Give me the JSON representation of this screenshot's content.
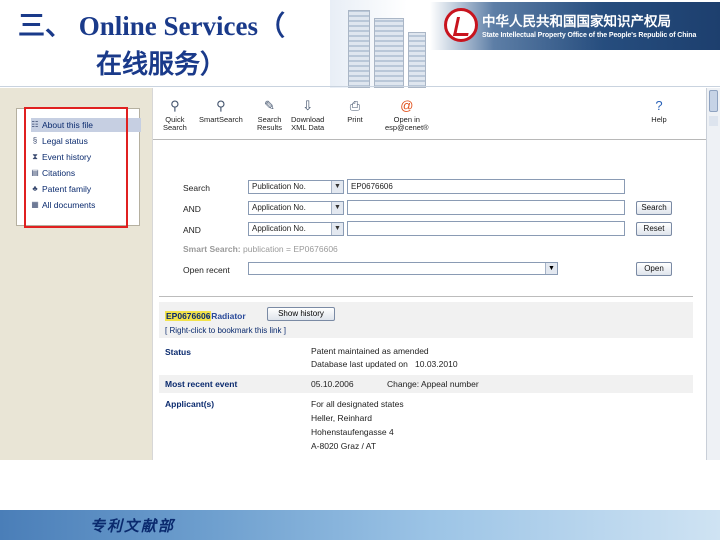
{
  "slide": {
    "title_line1": "三、 Online Services（",
    "title_line2": "在线服务）",
    "org_name_cn": "中华人民共和国国家知识产权局",
    "org_name_en": "State Intellectual Property Office of the People's Republic of China",
    "footer_text": "专利文献部"
  },
  "nav": {
    "items": [
      {
        "label": "About this file",
        "icon": "list-icon"
      },
      {
        "label": "Legal status",
        "icon": "legal-status-icon"
      },
      {
        "label": "Event history",
        "icon": "hourglass-icon"
      },
      {
        "label": "Citations",
        "icon": "citations-icon"
      },
      {
        "label": "Patent family",
        "icon": "family-icon"
      },
      {
        "label": "All documents",
        "icon": "documents-icon"
      }
    ]
  },
  "toolbar": {
    "items": [
      {
        "label1": "Quick",
        "label2": "Search",
        "icon": "quick-search-icon"
      },
      {
        "label1": "SmartSearch",
        "label2": "",
        "icon": "smart-search-icon"
      },
      {
        "label1": "Search",
        "label2": "Results",
        "icon": "search-results-icon"
      },
      {
        "label1": "Download",
        "label2": "XML Data",
        "icon": "download-icon"
      },
      {
        "label1": "Print",
        "label2": "",
        "icon": "print-icon"
      },
      {
        "label1": "Open in",
        "label2": "esp@cenet®",
        "icon": "espacenet-icon"
      },
      {
        "label1": "Help",
        "label2": "",
        "icon": "help-icon"
      }
    ]
  },
  "search": {
    "row1_label": "Search",
    "row1_field": "Publication No.",
    "row1_value": "EP0676606",
    "row2_label": "AND",
    "row2_field": "Application No.",
    "row2_value": "",
    "row3_label": "AND",
    "row3_field": "Application No.",
    "row3_value": "",
    "search_button": "Search",
    "reset_button": "Reset",
    "smart_search_label": "Smart Search:",
    "smart_search_query": "publication = EP0676606",
    "open_recent_label": "Open recent",
    "open_button": "Open"
  },
  "result": {
    "publication_number": "EP0676606",
    "title": "- Radiator",
    "show_history_button": "Show history",
    "bookmark_hint": "[ Right-click to bookmark this link ]",
    "status_label": "Status",
    "status_value": "Patent maintained as amended",
    "db_updated": "Database last updated on",
    "db_updated_date": "10.03.2010",
    "most_recent_event_label": "Most recent event",
    "most_recent_event_date": "05.10.2006",
    "most_recent_event_desc": "Change: Appeal number",
    "applicants_label": "Applicant(s)",
    "applicant_lines": [
      "For all designated states",
      "Heller, Reinhard",
      "Hohenstaufengasse 4",
      "A-8020 Graz / AT"
    ]
  },
  "colors": {
    "title": "#1a3a8a",
    "nav_highlight_frame": "#e02020",
    "pub_highlight": "#f3e34a",
    "link_blue": "#0a2a6e",
    "banner": "#264d7e"
  }
}
